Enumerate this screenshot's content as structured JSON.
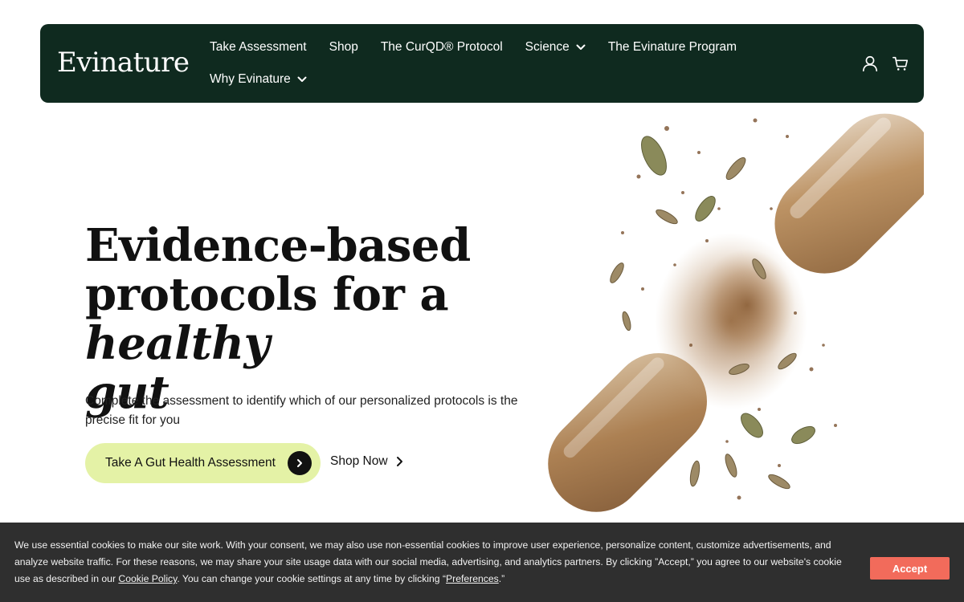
{
  "brand": {
    "logo_text": "Evinature",
    "header_bg": "#0f2a1f",
    "accent": "#e4f2a6"
  },
  "nav": {
    "row1": [
      {
        "label": "Take Assessment",
        "dropdown": false
      },
      {
        "label": "Shop",
        "dropdown": false
      },
      {
        "label": "The CurQD® Protocol",
        "dropdown": false
      },
      {
        "label": "Science",
        "dropdown": true
      },
      {
        "label": "The Evinature Program",
        "dropdown": false
      }
    ],
    "row2": [
      {
        "label": "Why Evinature",
        "dropdown": true
      }
    ],
    "icons": [
      "account-icon",
      "cart-icon"
    ]
  },
  "hero": {
    "title_line1": "Evidence-based",
    "title_line2_plain": "protocols for a ",
    "title_line2_em": "healthy",
    "title_line3_em": "gut",
    "subtitle": "Complete the assessment to identify which of our personalized protocols is the precise fit for you",
    "cta_primary": "Take A Gut Health Assessment",
    "cta_secondary": "Shop Now"
  },
  "cookie": {
    "text_before_link": "We use essential cookies to make our site work. With your consent, we may also use non-essential cookies to improve user experience, personalize content, customize advertisements, and analyze website traffic. For these reasons, we may share your site usage data with our social media, advertising, and analytics partners. By clicking ”Accept,” you agree to our website's cookie use as described in our ",
    "policy_link": "Cookie Policy",
    "text_middle": ". You can change your cookie settings at any time by clicking “",
    "preferences_link": "Preferences",
    "text_end": ".”",
    "accept_label": "Accept",
    "accept_color": "#f26b5b"
  }
}
